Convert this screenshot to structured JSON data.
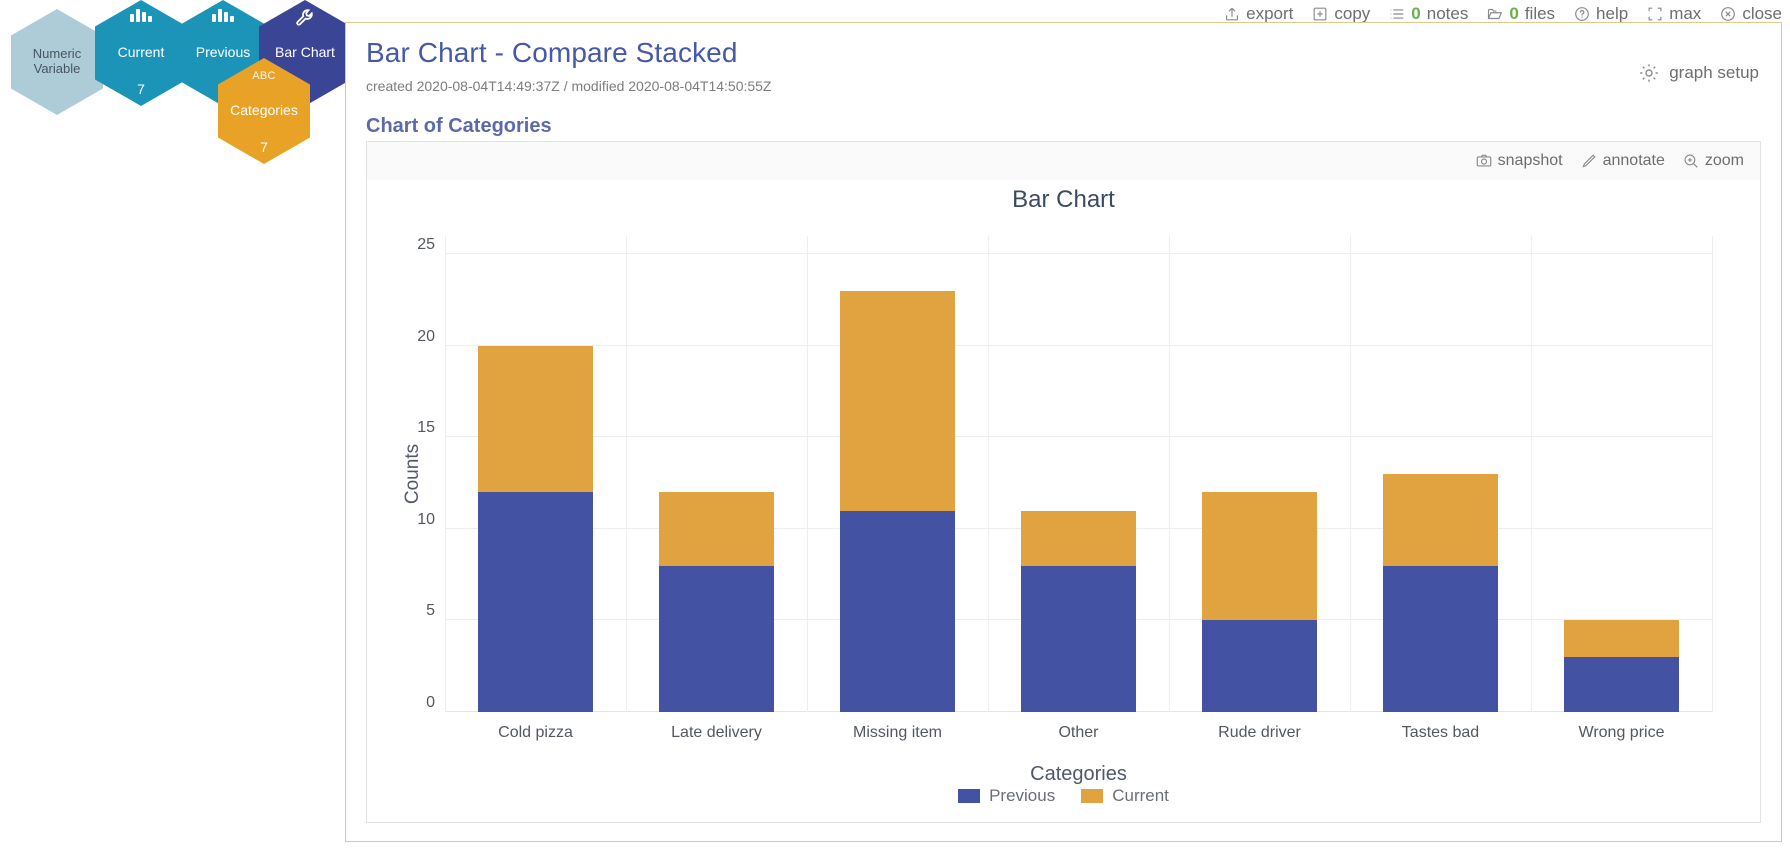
{
  "toolbar": {
    "items": [
      {
        "icon": "export-icon",
        "label": "export",
        "count": null
      },
      {
        "icon": "copy-icon",
        "label": "copy",
        "count": null
      },
      {
        "icon": "notes-icon",
        "label": "notes",
        "count": "0"
      },
      {
        "icon": "files-icon",
        "label": "files",
        "count": "0"
      },
      {
        "icon": "help-icon",
        "label": "help",
        "count": null
      },
      {
        "icon": "max-icon",
        "label": "max",
        "count": null
      },
      {
        "icon": "close-icon",
        "label": "close",
        "count": null
      }
    ],
    "count_color": "#6ab04c"
  },
  "node_map": {
    "nodes": [
      {
        "id": "numeric-variable",
        "title": "Numeric\nVariable",
        "sub": null,
        "count": null,
        "glyph": null,
        "color": "#aeccd8"
      },
      {
        "id": "current",
        "title": "Current",
        "sub": null,
        "count": "7",
        "glyph": "bar-chart-icon",
        "color": "#1b94b8"
      },
      {
        "id": "previous",
        "title": "Previous",
        "sub": null,
        "count": "7",
        "glyph": "bar-chart-icon",
        "color": "#1b94b8"
      },
      {
        "id": "bar-chart",
        "title": "Bar Chart",
        "sub": null,
        "count": null,
        "glyph": "wrench-icon",
        "color": "#3b4595"
      },
      {
        "id": "categories",
        "title": "Categories",
        "sub": "ABC",
        "count": "7",
        "glyph": null,
        "color": "#e8a225"
      }
    ]
  },
  "panel": {
    "title": "Bar Chart - Compare Stacked",
    "meta": "created 2020-08-04T14:49:37Z / modified 2020-08-04T14:50:55Z",
    "graph_setup_label": "graph setup",
    "section_title": "Chart of Categories",
    "title_color": "#4559a8"
  },
  "chart_tools": [
    {
      "icon": "camera-icon",
      "label": "snapshot"
    },
    {
      "icon": "pencil-icon",
      "label": "annotate"
    },
    {
      "icon": "zoom-in-icon",
      "label": "zoom"
    }
  ],
  "chart_data": {
    "type": "bar",
    "stacked": true,
    "title": "Bar Chart",
    "xlabel": "Categories",
    "ylabel": "Counts",
    "categories": [
      "Cold pizza",
      "Late delivery",
      "Missing item",
      "Other",
      "Rude driver",
      "Tastes bad",
      "Wrong price"
    ],
    "series": [
      {
        "name": "Previous",
        "color": "#4452a3",
        "values": [
          12,
          8,
          11,
          8,
          5,
          8,
          3
        ]
      },
      {
        "name": "Current",
        "color": "#e0a33f",
        "values": [
          8,
          4,
          12,
          3,
          7,
          5,
          2
        ]
      }
    ],
    "totals": [
      20,
      12,
      23,
      11,
      12,
      13,
      5
    ],
    "ylim": [
      0,
      26
    ],
    "yticks": [
      0,
      5,
      10,
      15,
      20,
      25
    ],
    "grid": true,
    "legend_position": "bottom"
  }
}
